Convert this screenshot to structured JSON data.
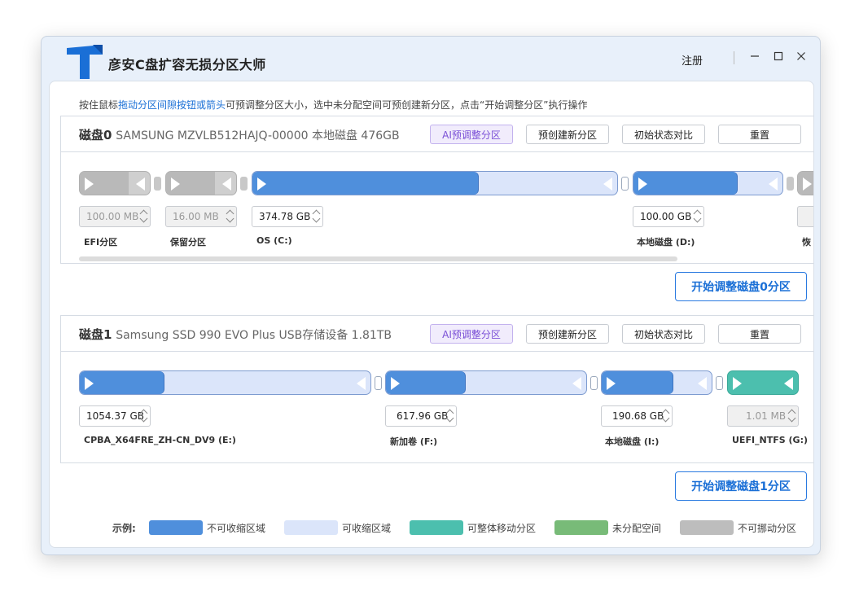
{
  "app": {
    "title": "彦安C盘扩容无损分区大师",
    "register_label": "注册"
  },
  "hint": {
    "prefix": "按住鼠标",
    "highlight": "拖动分区间隙按钮或箭头",
    "suffix": "可预调整分区大小，选中未分配空间可预创建新分区，点击“开始调整分区”执行操作"
  },
  "colors": {
    "non_shrinkable": "#4f8fdc",
    "shrinkable": "#dbe5fa",
    "movable": "#4cbfae",
    "unallocated": "#78bb78",
    "immovable": "#bdbdbd",
    "accent": "#1a6fd6"
  },
  "buttons": {
    "ai_adjust": "AI预调整分区",
    "pre_create": "预创建新分区",
    "compare": "初始状态对比",
    "reset": "重置"
  },
  "disks": [
    {
      "name": "磁盘0",
      "desc": "SAMSUNG MZVLB512HAJQ-00000 本地磁盘 476GB",
      "start_label": "开始调整磁盘0分区",
      "partitions": [
        {
          "label": "EFI分区",
          "size": "100.00 MB",
          "kind": "immovable",
          "used_fraction": 0.7,
          "disabled": true
        },
        {
          "label": "保留分区",
          "size": "16.00 MB",
          "kind": "immovable",
          "used_fraction": 0.7,
          "disabled": true
        },
        {
          "label": "OS (C:)",
          "size": "374.78 GB",
          "kind": "normal",
          "used_fraction": 0.62,
          "disabled": false
        },
        {
          "label": "本地磁盘 (D:)",
          "size": "100.00 GB",
          "kind": "normal",
          "used_fraction": 0.7,
          "disabled": false
        },
        {
          "label": "恢",
          "size": "",
          "kind": "immovable",
          "used_fraction": 0.5,
          "disabled": true
        }
      ]
    },
    {
      "name": "磁盘1",
      "desc": "Samsung SSD 990 EVO Plus USB存储设备 1.81TB",
      "start_label": "开始调整磁盘1分区",
      "partitions": [
        {
          "label": "CPBA_X64FRE_ZH-CN_DV9 (E:)",
          "size": "1054.37 GB",
          "kind": "normal",
          "used_fraction": 0.29,
          "disabled": false
        },
        {
          "label": "新加卷 (F:)",
          "size": "617.96 GB",
          "kind": "normal",
          "used_fraction": 0.4,
          "disabled": false
        },
        {
          "label": "本地磁盘 (I:)",
          "size": "190.68 GB",
          "kind": "normal",
          "used_fraction": 0.65,
          "disabled": false
        },
        {
          "label": "UEFI_NTFS (G:)",
          "size": "1.01 MB",
          "kind": "movable",
          "used_fraction": 1.0,
          "disabled": true
        }
      ]
    }
  ],
  "legend": {
    "title": "示例:",
    "items": [
      {
        "label": "不可收缩区域",
        "color": "#4f8fdc"
      },
      {
        "label": "可收缩区域",
        "color": "#dbe5fa"
      },
      {
        "label": "可整体移动分区",
        "color": "#4cbfae"
      },
      {
        "label": "未分配空间",
        "color": "#78bb78"
      },
      {
        "label": "不可挪动分区",
        "color": "#bdbdbd"
      }
    ]
  }
}
